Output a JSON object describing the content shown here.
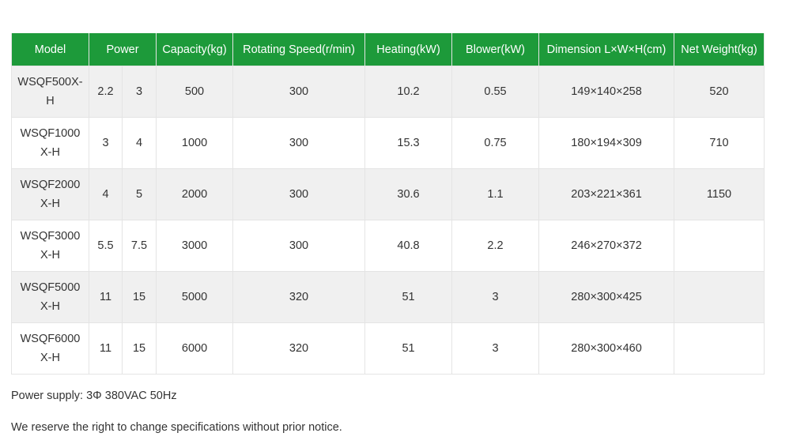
{
  "table": {
    "headers": {
      "model": "Model",
      "power": "Power",
      "capacity": "Capacity(kg)",
      "speed": "Rotating Speed(r/min)",
      "heating": "Heating(kW)",
      "blower": "Blower(kW)",
      "dimension": "Dimension L×W×H(cm)",
      "weight": "Net Weight(kg)"
    },
    "rows": [
      {
        "model": "WSQF500X-H",
        "power1": "2.2",
        "power2": "3",
        "capacity": "500",
        "speed": "300",
        "heating": "10.2",
        "blower": "0.55",
        "dimension": "149×140×258",
        "weight": "520"
      },
      {
        "model": "WSQF1000X-H",
        "power1": "3",
        "power2": "4",
        "capacity": "1000",
        "speed": "300",
        "heating": "15.3",
        "blower": "0.75",
        "dimension": "180×194×309",
        "weight": "710"
      },
      {
        "model": "WSQF2000X-H",
        "power1": "4",
        "power2": "5",
        "capacity": "2000",
        "speed": "300",
        "heating": "30.6",
        "blower": "1.1",
        "dimension": "203×221×361",
        "weight": "1150"
      },
      {
        "model": "WSQF3000X-H",
        "power1": "5.5",
        "power2": "7.5",
        "capacity": "3000",
        "speed": "300",
        "heating": "40.8",
        "blower": "2.2",
        "dimension": "246×270×372",
        "weight": ""
      },
      {
        "model": "WSQF5000X-H",
        "power1": "11",
        "power2": "15",
        "capacity": "5000",
        "speed": "320",
        "heating": "51",
        "blower": "3",
        "dimension": "280×300×425",
        "weight": ""
      },
      {
        "model": "WSQF6000X-H",
        "power1": "11",
        "power2": "15",
        "capacity": "6000",
        "speed": "320",
        "heating": "51",
        "blower": "3",
        "dimension": "280×300×460",
        "weight": ""
      }
    ]
  },
  "notes": {
    "power_supply": "Power supply: 3Φ 380VAC 50Hz",
    "reserve": "We reserve the right to change specifications without prior notice."
  },
  "colors": {
    "header_bg": "#1d9a3a",
    "header_text": "#ffffff",
    "row_alt_bg": "#f0f0f0",
    "border": "#e4e4e4"
  }
}
